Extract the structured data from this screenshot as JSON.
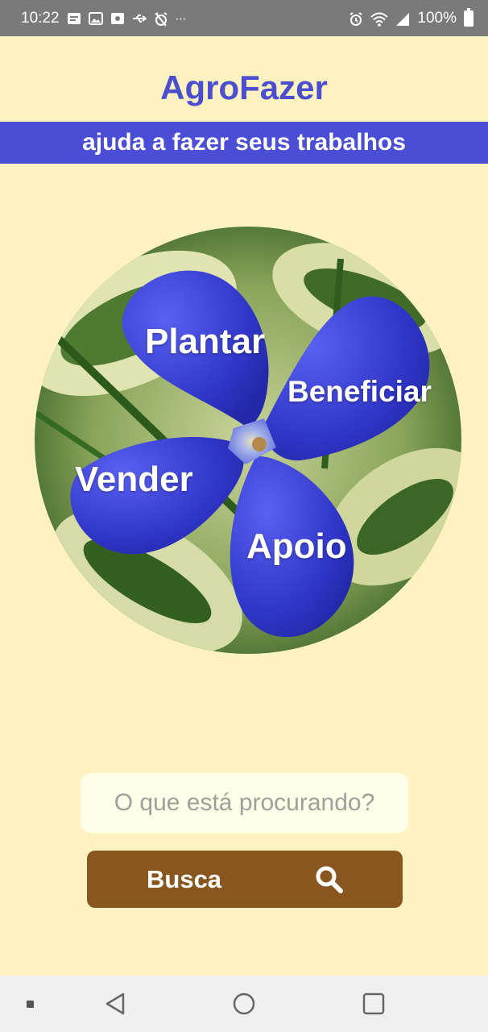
{
  "status_bar": {
    "time": "10:22",
    "battery_text": "100%",
    "left_icons": [
      "notification-icon",
      "image-icon",
      "screenshot-icon",
      "usb-icon",
      "alarm-off-icon",
      "more-icon"
    ],
    "right_icons": [
      "alarm-icon",
      "wifi-icon",
      "signal-icon",
      "battery-icon"
    ]
  },
  "header": {
    "title": "AgroFazer",
    "subtitle": "ajuda a fazer seus trabalhos"
  },
  "menu": {
    "plantar": "Plantar",
    "beneficiar": "Beneficiar",
    "vender": "Vender",
    "apoio": "Apoio"
  },
  "search": {
    "placeholder": "O que está procurando?",
    "value": "",
    "button_label": "Busca",
    "button_icon": "search-icon"
  },
  "nav": {
    "icons": [
      "recent-dot-icon",
      "back-icon",
      "home-icon",
      "overview-icon"
    ]
  },
  "colors": {
    "background": "#fef3c0",
    "title": "#4a4ecf",
    "subtitle_band": "#4a4ed6",
    "button": "#8a5620",
    "status_bar": "#7a7a7a",
    "petal": "#3b3fd0"
  }
}
